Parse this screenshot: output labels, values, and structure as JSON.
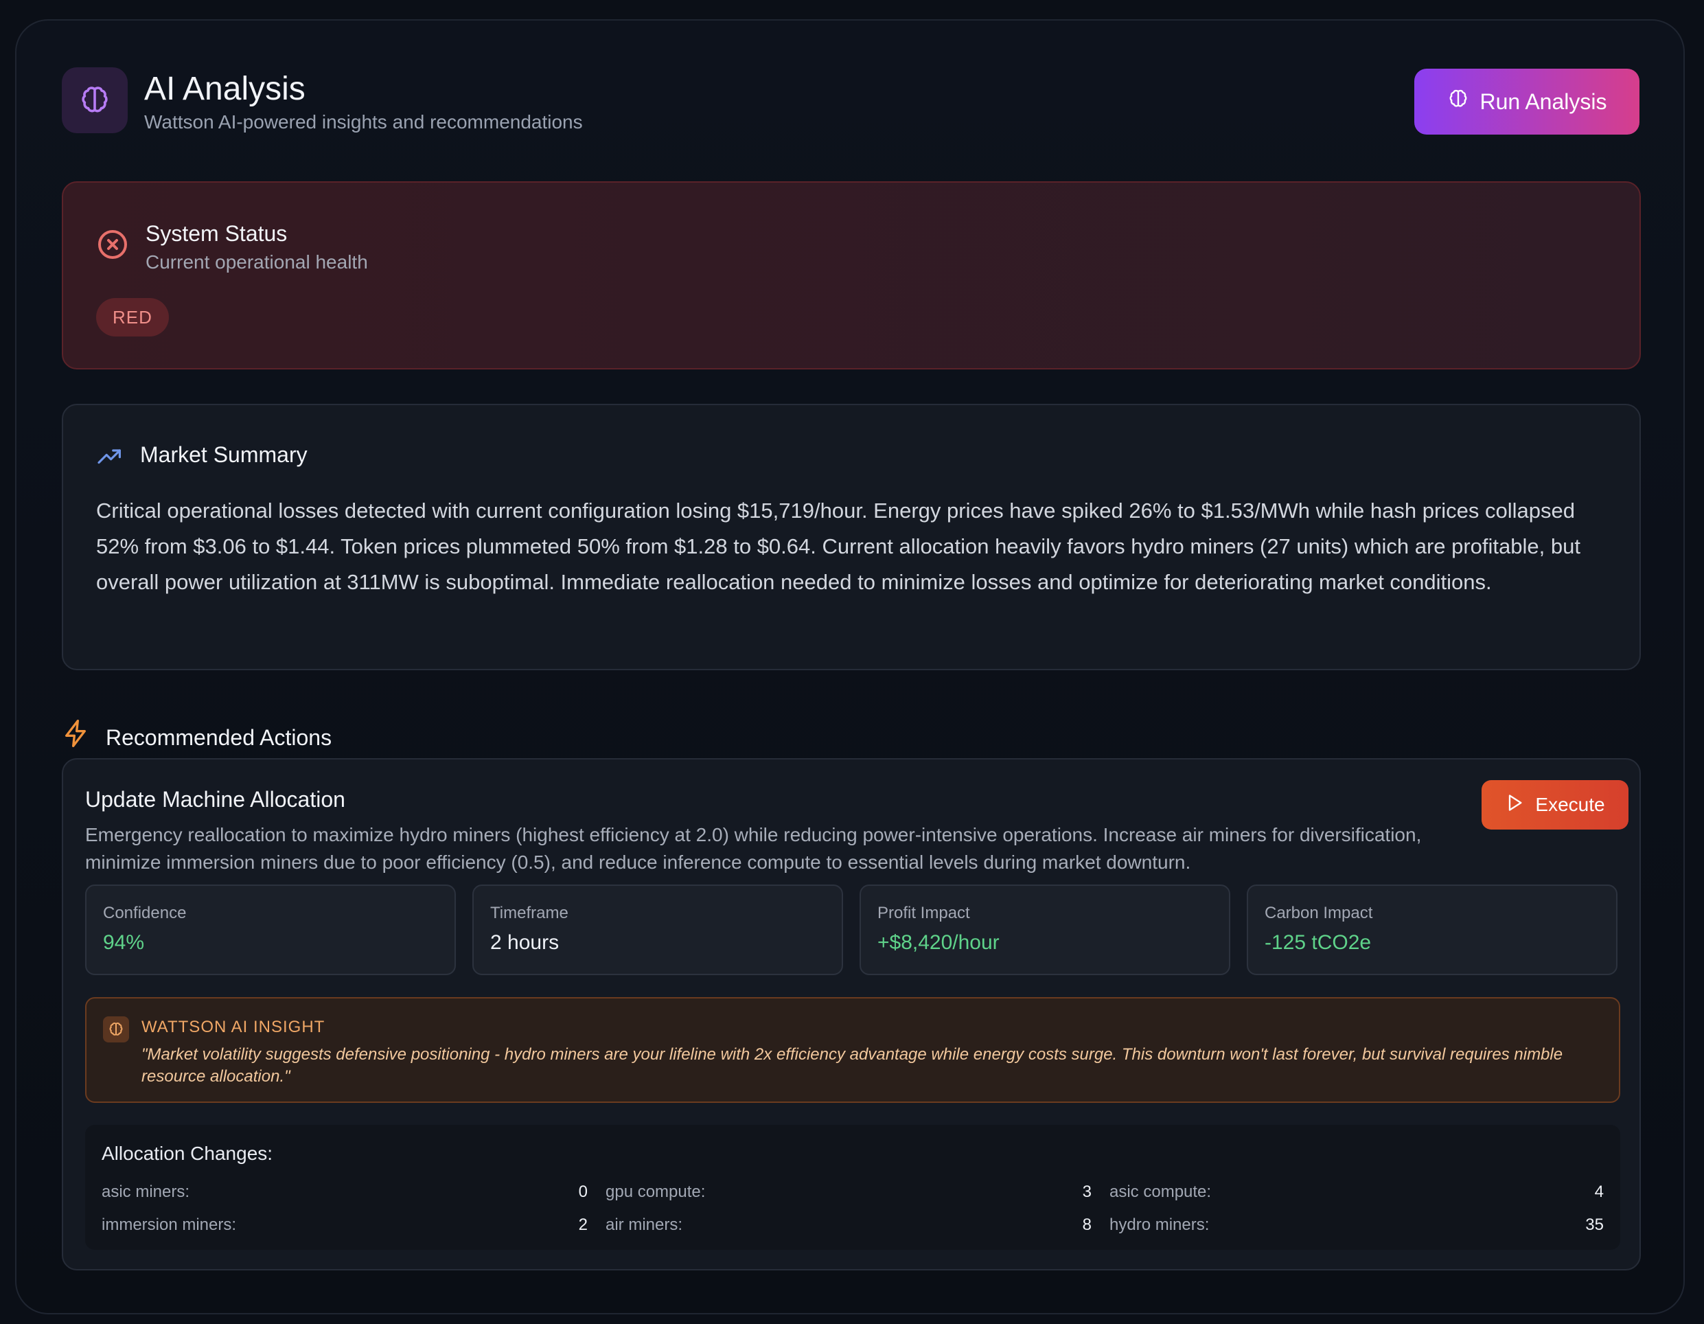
{
  "header": {
    "title": "AI Analysis",
    "subtitle": "Wattson AI-powered insights and recommendations",
    "run_button_label": "Run Analysis",
    "icon": "brain-icon"
  },
  "status": {
    "title": "System Status",
    "subtitle": "Current operational health",
    "badge": "RED",
    "icon": "x-circle-icon",
    "color": "#e8706b"
  },
  "market": {
    "title": "Market Summary",
    "icon": "trending-up-icon",
    "text": "Critical operational losses detected with current configuration losing $15,719/hour. Energy prices have spiked 26% to $1.53/MWh while hash prices collapsed 52% from $3.06 to $1.44. Token prices plummeted 50% from $1.28 to $0.64. Current allocation heavily favors hydro miners (27 units) which are profitable, but overall power utilization at 311MW is suboptimal. Immediate reallocation needed to minimize losses and optimize for deteriorating market conditions."
  },
  "recommended": {
    "title": "Recommended Actions",
    "icon": "lightning-icon"
  },
  "action": {
    "title": "Update Machine Allocation",
    "description": "Emergency reallocation to maximize hydro miners (highest efficiency at 2.0) while reducing power-intensive operations. Increase air miners for diversification, minimize immersion miners due to poor efficiency (0.5), and reduce inference compute to essential levels during market downturn.",
    "execute_label": "Execute",
    "metrics": [
      {
        "label": "Confidence",
        "value": "94%",
        "color": "#5fd38a"
      },
      {
        "label": "Timeframe",
        "value": "2 hours",
        "color": "#eef1f6"
      },
      {
        "label": "Profit Impact",
        "value": "+$8,420/hour",
        "color": "#5fd38a"
      },
      {
        "label": "Carbon Impact",
        "value": "-125 tCO2e",
        "color": "#5fd38a"
      }
    ],
    "insight": {
      "label": "WATTSON AI INSIGHT",
      "text": "\"Market volatility suggests defensive positioning - hydro miners are your lifeline with 2x efficiency advantage while energy costs surge. This downturn won't last forever, but survival requires nimble resource allocation.\""
    },
    "allocation": {
      "title": "Allocation Changes:",
      "rows": [
        [
          {
            "k": "asic miners:",
            "v": "0"
          },
          {
            "k": "gpu compute:",
            "v": "3"
          },
          {
            "k": "asic compute:",
            "v": "4"
          }
        ],
        [
          {
            "k": "immersion miners:",
            "v": "2"
          },
          {
            "k": "air miners:",
            "v": "8"
          },
          {
            "k": "hydro miners:",
            "v": "35"
          }
        ]
      ]
    }
  }
}
